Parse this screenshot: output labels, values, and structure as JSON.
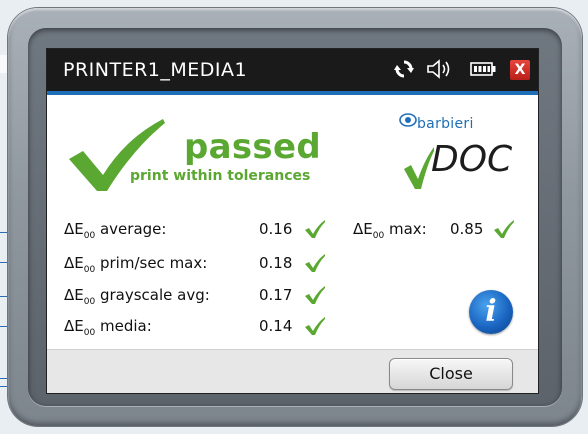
{
  "window": {
    "title": "PRINTER1_MEDIA1",
    "close_label": "X"
  },
  "result": {
    "status": "passed",
    "detail": "print within tolerances"
  },
  "brand": {
    "name": "barbieri",
    "product": "DOC"
  },
  "metrics": [
    {
      "prefix": "ΔE",
      "sub": "00",
      "label": "average:",
      "value": "0.16"
    },
    {
      "prefix": "ΔE",
      "sub": "00",
      "label": "prim/sec max:",
      "value": "0.18"
    },
    {
      "prefix": "ΔE",
      "sub": "00",
      "label": "grayscale avg:",
      "value": "0.17"
    },
    {
      "prefix": "ΔE",
      "sub": "00",
      "label": "media:",
      "value": "0.14"
    }
  ],
  "max_metric": {
    "prefix": "ΔE",
    "sub": "00",
    "label": "max:",
    "value": "0.85"
  },
  "buttons": {
    "info_glyph": "i",
    "close_label": "Close"
  },
  "colors": {
    "pass_green": "#5aa832",
    "accent_blue": "#1f6fb8",
    "titlebar": "#1a1a1a",
    "close_red": "#d2322b"
  },
  "icons": [
    "refresh-icon",
    "speaker-icon",
    "battery-icon",
    "close-icon",
    "check-icon",
    "info-icon",
    "barbieri-logo-icon"
  ]
}
